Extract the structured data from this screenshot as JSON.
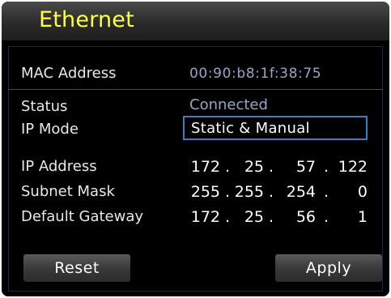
{
  "title": "Ethernet",
  "mac": {
    "label": "MAC Address",
    "value": "00:90:b8:1f:38:75"
  },
  "status": {
    "label": "Status",
    "value": "Connected"
  },
  "ip_mode": {
    "label": "IP Mode",
    "value": "Static & Manual"
  },
  "ip_address": {
    "label": "IP Address",
    "octets": [
      "172",
      "25",
      "57",
      "122"
    ]
  },
  "subnet_mask": {
    "label": "Subnet Mask",
    "octets": [
      "255",
      "255",
      "254",
      "0"
    ]
  },
  "default_gateway": {
    "label": "Default Gateway",
    "octets": [
      "172",
      "25",
      "56",
      "1"
    ]
  },
  "separator": ".",
  "buttons": {
    "reset_label": "Reset",
    "apply_label": "Apply"
  },
  "colors": {
    "title": "#ffff3c",
    "value_blue": "#8fa9c4",
    "focus_border": "#3c7cc0",
    "background": "#000000"
  }
}
